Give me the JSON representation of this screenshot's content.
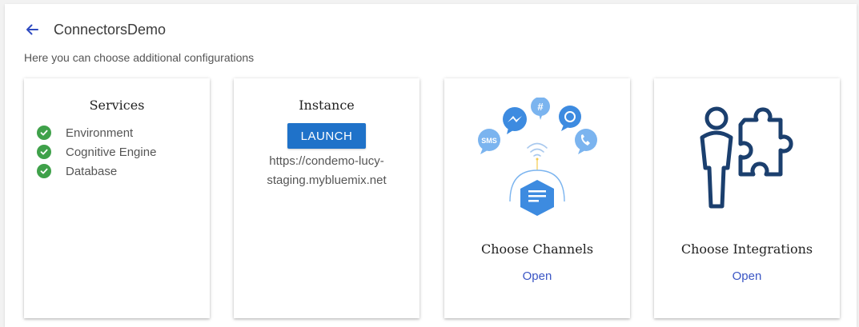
{
  "header": {
    "title": "ConnectorsDemo",
    "subtitle": "Here you can choose additional configurations"
  },
  "cards": {
    "services": {
      "title": "Services",
      "items": [
        {
          "label": "Environment",
          "status": "ok"
        },
        {
          "label": "Cognitive Engine",
          "status": "ok"
        },
        {
          "label": "Database",
          "status": "ok"
        }
      ]
    },
    "instance": {
      "title": "Instance",
      "launch_label": "LAUNCH",
      "url_line1": "https://condemo-lucy-",
      "url_line2": "staging.mybluemix.net"
    },
    "channels": {
      "title": "Choose Channels",
      "open_label": "Open",
      "sms_label": "SMS"
    },
    "integrations": {
      "title": "Choose Integrations",
      "open_label": "Open"
    }
  },
  "colors": {
    "accent": "#3a55c4",
    "launch": "#1f72c9",
    "check": "#3fa14a",
    "integration_icon": "#1b3f6e",
    "channel_blue": "#3d8be0",
    "channel_light": "#7bb4ef"
  }
}
